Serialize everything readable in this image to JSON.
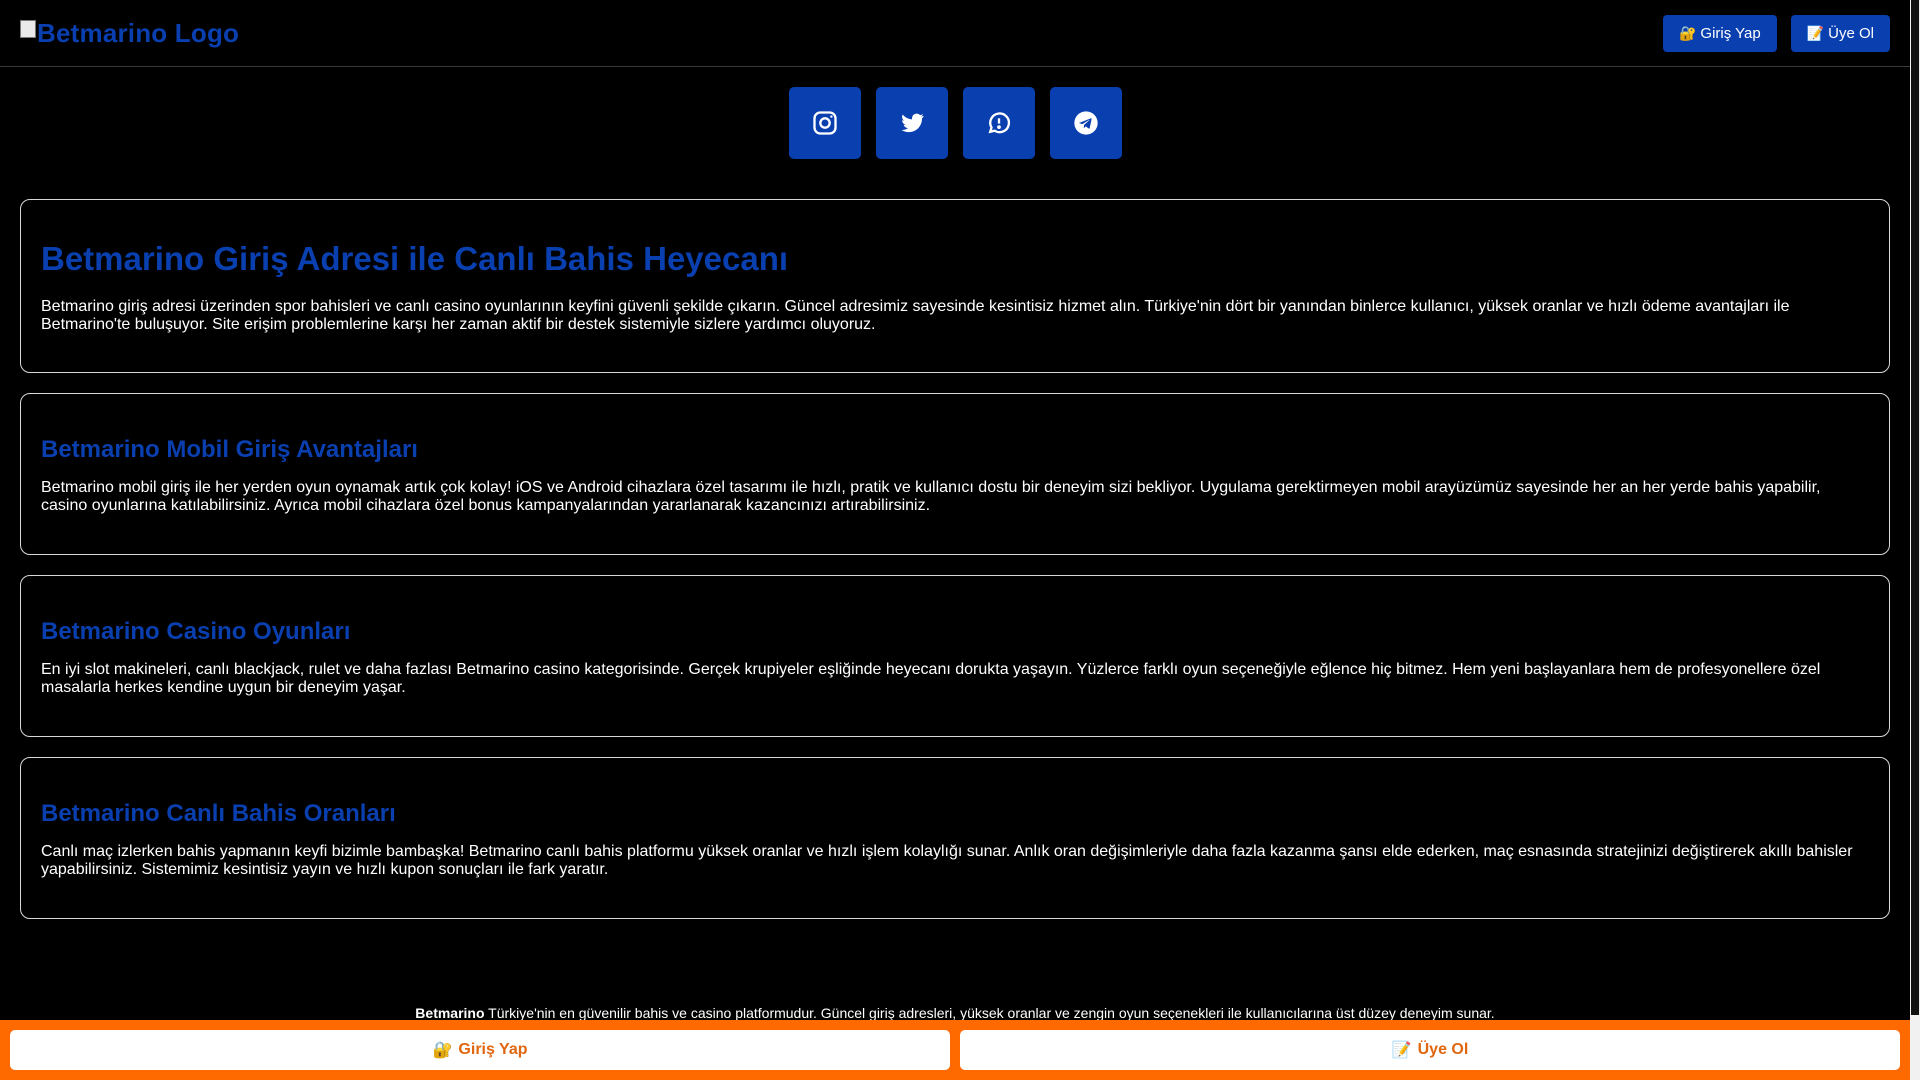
{
  "header": {
    "logo_alt": "Betmarino Logo",
    "login_label": "Giriş Yap",
    "login_emoji": "🔐",
    "register_label": "Üye Ol",
    "register_emoji": "📝"
  },
  "social": [
    {
      "name": "instagram-icon"
    },
    {
      "name": "twitter-icon"
    },
    {
      "name": "whatsapp-icon"
    },
    {
      "name": "telegram-icon"
    }
  ],
  "sections": [
    {
      "title": "Betmarino Giriş Adresi ile Canlı Bahis Heyecanı",
      "text": "Betmarino giriş adresi üzerinden spor bahisleri ve canlı casino oyunlarının keyfini güvenli şekilde çıkarın. Güncel adresimiz sayesinde kesintisiz hizmet alın. Türkiye'nin dört bir yanından binlerce kullanıcı, yüksek oranlar ve hızlı ödeme avantajları ile Betmarino'te buluşuyor. Site erişim problemlerine karşı her zaman aktif bir destek sistemiyle sizlere yardımcı oluyoruz."
    },
    {
      "title": "Betmarino Mobil Giriş Avantajları",
      "text": "Betmarino mobil giriş ile her yerden oyun oynamak artık çok kolay! iOS ve Android cihazlara özel tasarımı ile hızlı, pratik ve kullanıcı dostu bir deneyim sizi bekliyor. Uygulama gerektirmeyen mobil arayüzümüz sayesinde her an her yerde bahis yapabilir, casino oyunlarına katılabilirsiniz. Ayrıca mobil cihazlara özel bonus kampanyalarından yararlanarak kazancınızı artırabilirsiniz."
    },
    {
      "title": "Betmarino Casino Oyunları",
      "text": "En iyi slot makineleri, canlı blackjack, rulet ve daha fazlası Betmarino casino kategorisinde. Gerçek krupiyeler eşliğinde heyecanı dorukta yaşayın. Yüzlerce farklı oyun seçeneğiyle eğlence hiç bitmez. Hem yeni başlayanlara hem de profesyonellere özel masalarla herkes kendine uygun bir deneyim yaşar."
    },
    {
      "title": "Betmarino Canlı Bahis Oranları",
      "text": "Canlı maç izlerken bahis yapmanın keyfi bizimle bambaşka! Betmarino canlı bahis platformu yüksek oranlar ve hızlı işlem kolaylığı sunar. Anlık oran değişimleriyle daha fazla kazanma şansı elde ederken, maç esnasında stratejinizi değiştirerek akıllı bahisler yapabilirsiniz. Sistemimiz kesintisiz yayın ve hızlı kupon sonuçları ile fark yaratır."
    }
  ],
  "footer": {
    "brand": "Betmarino",
    "text": " Türkiye'nin en güvenilir bahis ve casino platformudur. Güncel giriş adresleri, yüksek oranlar ve zengin oyun seçenekleri ile kullanıcılarına üst düzey deneyim sunar."
  },
  "bottom_bar": {
    "login_label": "Giriş Yap",
    "login_emoji": "🔐",
    "register_label": "Üye Ol",
    "register_emoji": "📝"
  },
  "colors": {
    "accent_blue": "#0a3fb0",
    "bottom_bar_orange": "#ff6a00",
    "background": "#000000"
  }
}
